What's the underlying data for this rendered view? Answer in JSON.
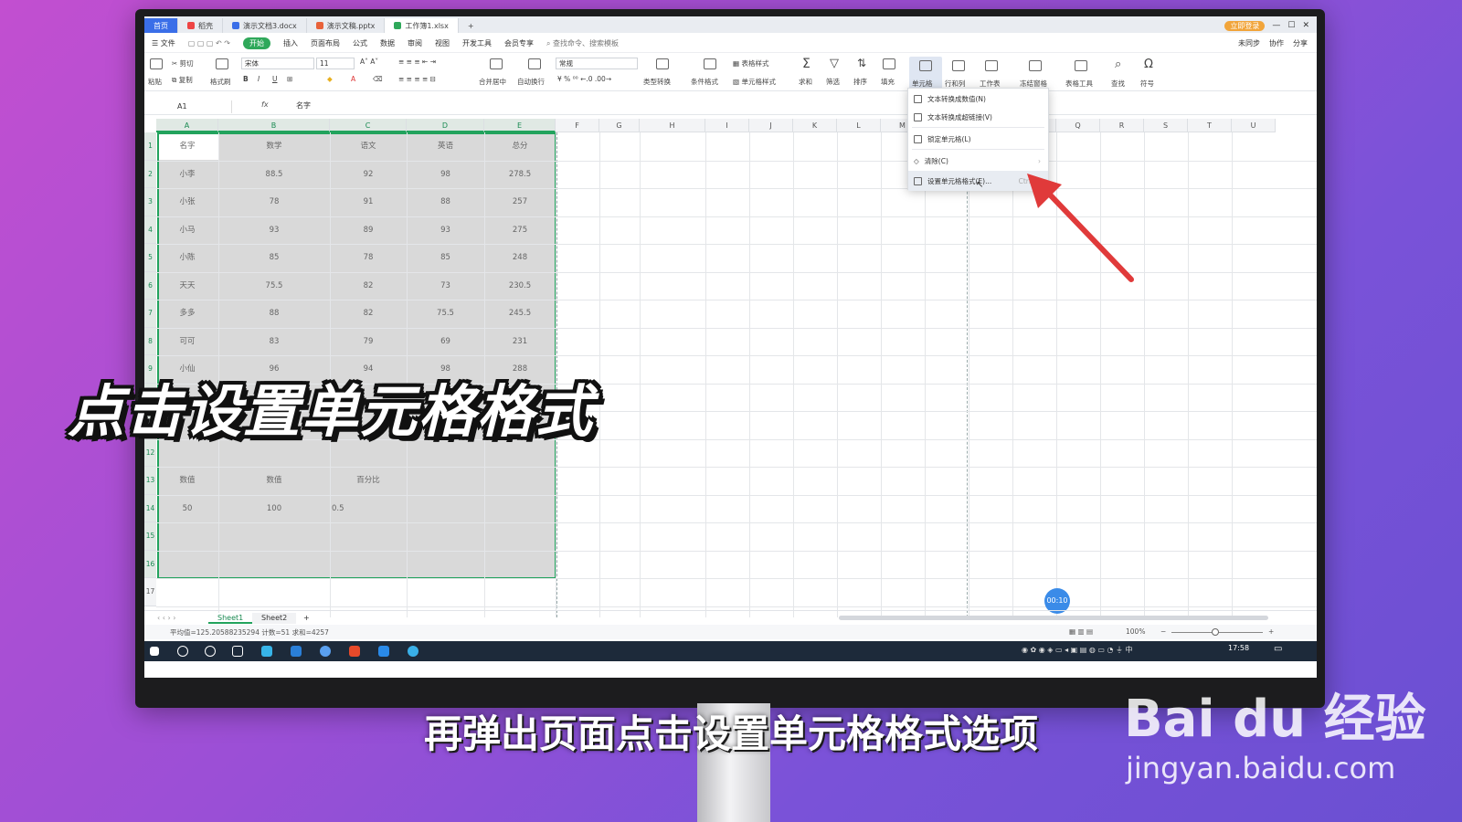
{
  "tabs": [
    {
      "label": "首页"
    },
    {
      "label": "稻壳"
    },
    {
      "label": "演示文档3.docx"
    },
    {
      "label": "演示文稿.pptx"
    },
    {
      "label": "工作簿1.xlsx"
    }
  ],
  "vip_label": "立即登录",
  "menu": {
    "file": "文件",
    "items": [
      "开始",
      "插入",
      "页面布局",
      "公式",
      "数据",
      "审阅",
      "视图",
      "开发工具",
      "会员专享"
    ],
    "search": "查找命令、搜索模板",
    "right": [
      "未同步",
      "协作",
      "分享"
    ]
  },
  "ribbon": {
    "paste": "粘贴",
    "cut": "剪切",
    "copy": "复制",
    "format_painter": "格式刷",
    "font_name": "宋体",
    "font_size": "11",
    "merge": "合并居中",
    "wrap": "自动换行",
    "number_format": "常规",
    "type_convert": "类型转换",
    "cond_format": "条件格式",
    "table_style": "表格样式",
    "cell_style": "单元格样式",
    "sum": "求和",
    "filter": "筛选",
    "sort": "排序",
    "fill": "填充",
    "cell": "单元格",
    "rowcol": "行和列",
    "sheet": "工作表",
    "freeze": "冻结窗格",
    "tools": "表格工具",
    "find": "查找",
    "symbol": "符号"
  },
  "formula_bar": {
    "name_box": "A1",
    "fx": "fx",
    "value": "名字"
  },
  "columns": [
    "A",
    "B",
    "C",
    "D",
    "E",
    "F",
    "G",
    "H",
    "I",
    "J",
    "K",
    "L",
    "M",
    "N",
    "O",
    "P",
    "Q",
    "R",
    "S",
    "T",
    "U"
  ],
  "rows": [
    "1",
    "2",
    "3",
    "4",
    "5",
    "6",
    "7",
    "8",
    "9",
    "10",
    "11",
    "12",
    "13",
    "14",
    "15",
    "16",
    "17"
  ],
  "table": {
    "headers": [
      "名字",
      "数学",
      "语文",
      "英语",
      "总分"
    ],
    "data": [
      [
        "小李",
        "88.5",
        "92",
        "98",
        "278.5"
      ],
      [
        "小张",
        "78",
        "91",
        "88",
        "257"
      ],
      [
        "小马",
        "93",
        "89",
        "93",
        "275"
      ],
      [
        "小陈",
        "85",
        "78",
        "85",
        "248"
      ],
      [
        "天天",
        "75.5",
        "82",
        "73",
        "230.5"
      ],
      [
        "多多",
        "88",
        "82",
        "75.5",
        "245.5"
      ],
      [
        "可可",
        "83",
        "79",
        "69",
        "231"
      ],
      [
        "小仙",
        "96",
        "94",
        "98",
        "288"
      ]
    ],
    "row13": [
      "数值",
      "数值",
      "百分比"
    ],
    "row14": [
      "50",
      "100",
      "0.5"
    ]
  },
  "dropdown": {
    "items": [
      {
        "label": "文本转换成数值(N)"
      },
      {
        "label": "文本转换成超链接(V)"
      },
      {
        "label": "锁定单元格(L)"
      },
      {
        "label": "清除(C)"
      },
      {
        "label": "设置单元格格式(E)...",
        "shortcut": "Ctrl+1"
      }
    ]
  },
  "sheets": [
    "Sheet1",
    "Sheet2"
  ],
  "status": {
    "summary": "平均值=125.20588235294  计数=51  求和=4257",
    "zoom": "100%",
    "time": "17:58"
  },
  "timer": "00:10",
  "overlay": {
    "caption": "点击设置单元格格式",
    "subtitle": "再弹出页面点击设置单元格格式选项",
    "watermark_brand": "Bai du 经验",
    "watermark_url": "jingyan.baidu.com"
  },
  "colors": {
    "background": "#9a4fd6",
    "selection_border": "#22a35d",
    "accent_green": "#2fa85a",
    "arrow_red": "#e03a3a"
  }
}
